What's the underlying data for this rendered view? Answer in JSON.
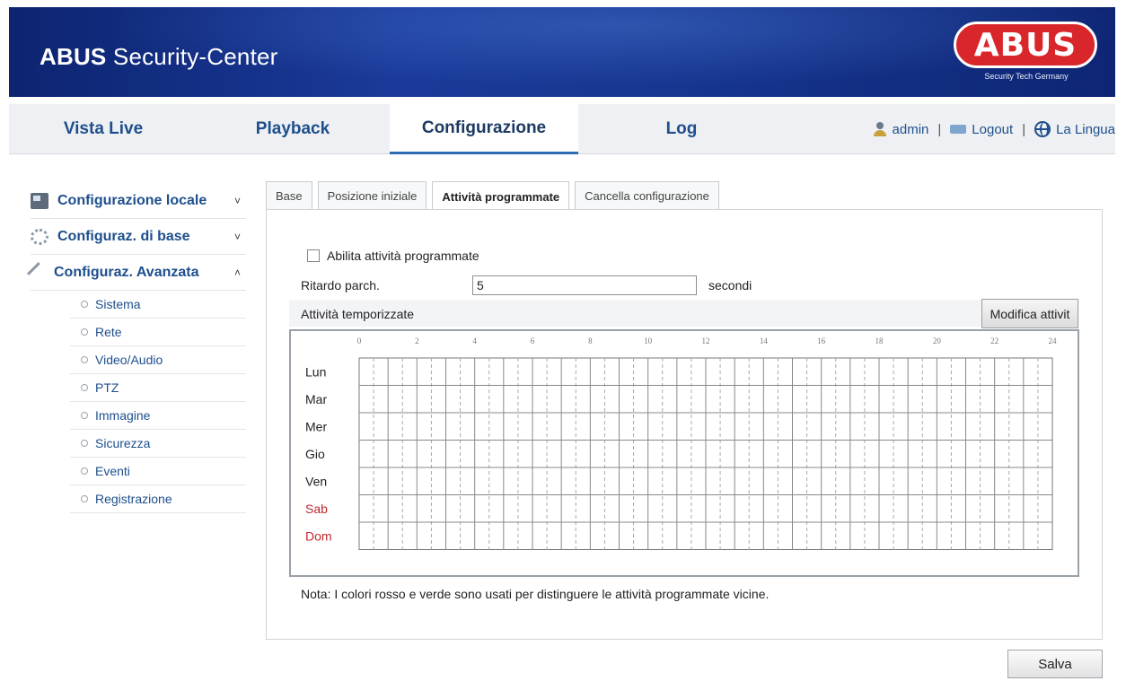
{
  "header": {
    "title_bold": "ABUS",
    "title_rest": " Security-Center",
    "logo_text": "ABUS",
    "logo_tagline": "Security Tech Germany",
    "logo_color": "#d8262b"
  },
  "nav": {
    "tabs": [
      {
        "label": "Vista Live",
        "active": false
      },
      {
        "label": "Playback",
        "active": false
      },
      {
        "label": "Configurazione",
        "active": true
      },
      {
        "label": "Log",
        "active": false
      }
    ],
    "user": "admin",
    "logout": "Logout",
    "language": "La Lingua",
    "separator": "|"
  },
  "sidebar": {
    "groups": [
      {
        "label": "Configurazione locale",
        "icon": "local-config-icon",
        "chevron": "˅"
      },
      {
        "label": "Configuraz. di base",
        "icon": "gear-icon",
        "chevron": "˅"
      },
      {
        "label": "Configuraz. Avanzata",
        "icon": "wrench-icon",
        "chevron": "˄"
      }
    ],
    "items": [
      "Sistema",
      "Rete",
      "Video/Audio",
      "PTZ",
      "Immagine",
      "Sicurezza",
      "Eventi",
      "Registrazione"
    ]
  },
  "content": {
    "tabs": [
      {
        "label": "Base",
        "active": false
      },
      {
        "label": "Posizione iniziale",
        "active": false
      },
      {
        "label": "Attività programmate",
        "active": true
      },
      {
        "label": "Cancella configurazione",
        "active": false
      }
    ],
    "enable_label": "Abilita attività programmate",
    "enable_checked": false,
    "delay_label": "Ritardo parch.",
    "delay_value": "5",
    "delay_unit": "secondi",
    "timed_label": "Attività temporizzate",
    "modify_button": "Modifica attivit",
    "note": "Nota: I colori rosso e verde sono usati per distinguere le attività programmate vicine.",
    "save_button": "Salva"
  },
  "schedule": {
    "hour_labels": [
      "0",
      "2",
      "4",
      "6",
      "8",
      "10",
      "12",
      "14",
      "16",
      "18",
      "20",
      "22",
      "24"
    ],
    "days": [
      {
        "label": "Lun",
        "weekend": false
      },
      {
        "label": "Mar",
        "weekend": false
      },
      {
        "label": "Mer",
        "weekend": false
      },
      {
        "label": "Gio",
        "weekend": false
      },
      {
        "label": "Ven",
        "weekend": false
      },
      {
        "label": "Sab",
        "weekend": true
      },
      {
        "label": "Dom",
        "weekend": true
      }
    ],
    "weekend_color": "#c0282d",
    "weekday_color": "#222222"
  }
}
